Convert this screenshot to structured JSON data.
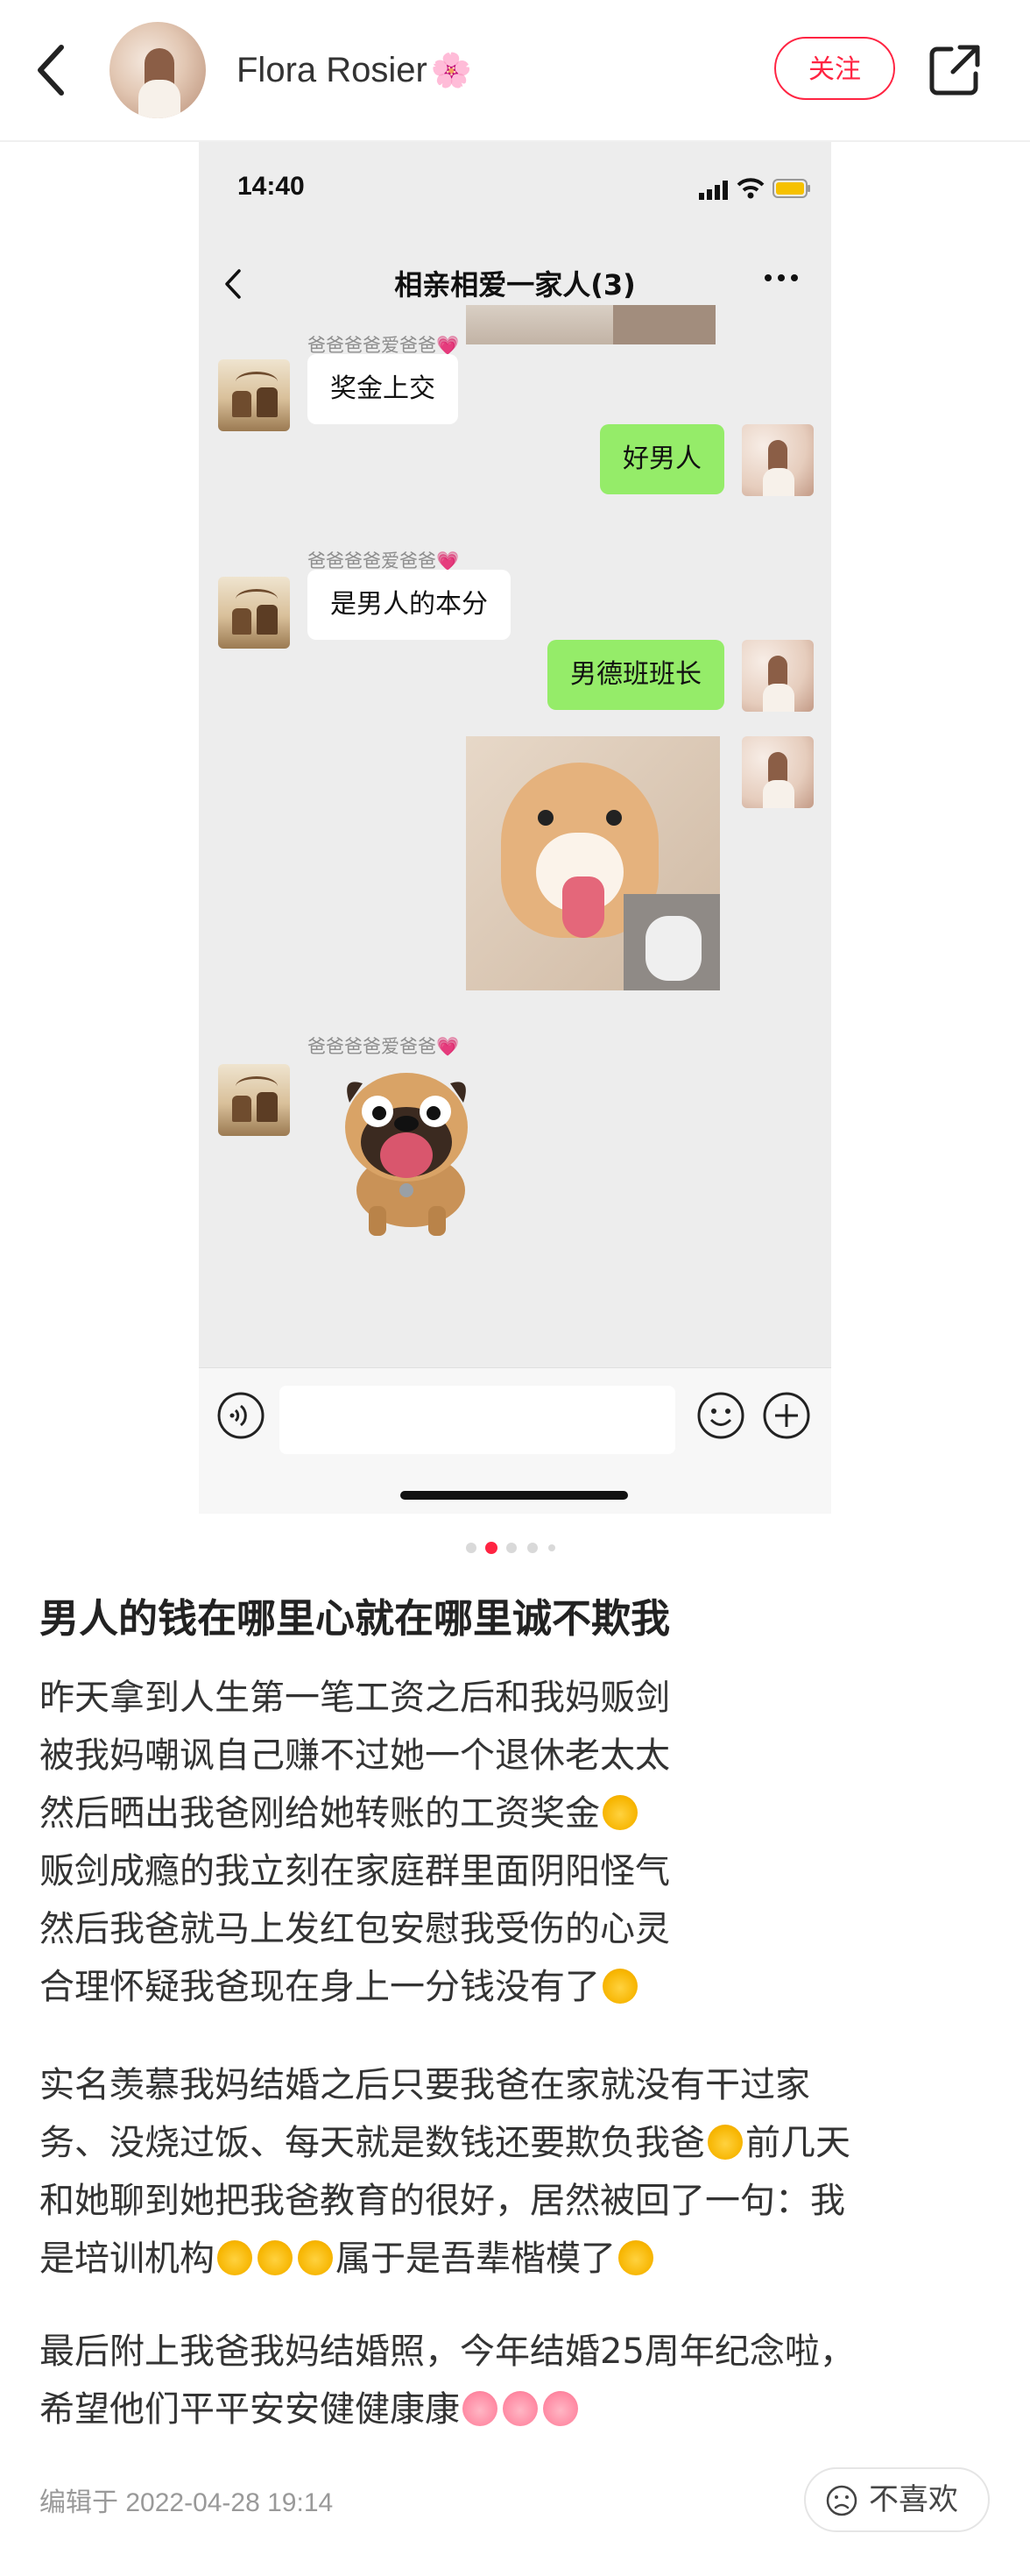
{
  "header": {
    "username": "Flora Rosier",
    "username_emoji": "🌸",
    "follow_label": "关注"
  },
  "phone_screenshot": {
    "status_time": "14:40",
    "chat_title": "相亲相爱一家人(3)",
    "messages": [
      {
        "sender": "爸爸爸爸爱爸爸",
        "heart": "💗",
        "text": "奖金上交",
        "side": "left"
      },
      {
        "text": "好男人",
        "side": "right"
      },
      {
        "sender": "爸爸爸爸爱爸爸",
        "heart": "💗",
        "text": "是男人的本分",
        "side": "left"
      },
      {
        "text": "男德班班长",
        "side": "right"
      },
      {
        "type": "image",
        "side": "right",
        "content": "shiba-thumbs-up"
      },
      {
        "sender": "爸爸爸爸爱爸爸",
        "heart": "💗",
        "type": "sticker",
        "side": "left",
        "content": "pug-sticker"
      }
    ]
  },
  "pager": {
    "total": 5,
    "active_index": 1
  },
  "post": {
    "title": "男人的钱在哪里心就在哪里诚不欺我",
    "para1": [
      "昨天拿到人生第一笔工资之后和我妈贩剑",
      "被我妈嘲讽自己赚不过她一个退休老太太",
      "然后晒出我爸刚给她转账的工资奖金",
      "贩剑成瘾的我立刻在家庭群里面阴阳怪气",
      "然后我爸就马上发红包安慰我受伤的心灵",
      "合理怀疑我爸现在身上一分钱没有了"
    ],
    "para2": [
      "实名羡慕我妈结婚之后只要我爸在家就没有干过家",
      "务、没烧过饭、每天就是数钱还要欺负我爸",
      "前几天",
      "和她聊到她把我爸教育的很好，居然被回了一句：我",
      "是培训机构",
      "属于是吾辈楷模了"
    ],
    "para3": [
      "最后附上我爸我妈结婚照，今年结婚25周年纪念啦，",
      "希望他们平平安安健健康康"
    ]
  },
  "footer": {
    "edited": "编辑于 2022-04-28 19:14",
    "dislike_label": "不喜欢"
  },
  "colors": {
    "brand": "#ff2442",
    "wechat_green": "#95ec69",
    "chat_bg": "#ededed"
  }
}
